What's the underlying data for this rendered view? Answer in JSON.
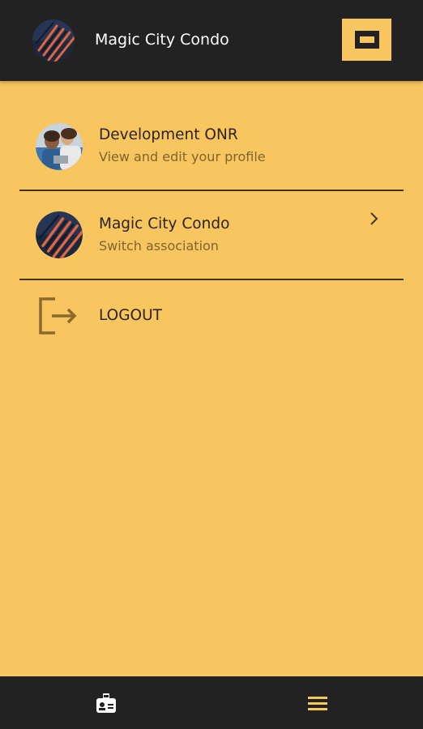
{
  "app_bar": {
    "title": "Magic City Condo",
    "logo_icon": "association-logo",
    "menu_icon": "menu-toggle-icon",
    "accent_color": "#f9c55e",
    "background_color": "#222222"
  },
  "profile": {
    "name": "Development ONR",
    "subtitle": "View and edit your profile",
    "avatar_icon": "user-avatar"
  },
  "association": {
    "name": "Magic City Condo",
    "subtitle": "Switch association",
    "avatar_icon": "association-logo",
    "chevron_icon": "chevron-right-icon"
  },
  "logout": {
    "label": "LOGOUT",
    "icon": "logout-icon"
  },
  "bottom_nav": {
    "items": [
      {
        "icon": "id-badge-icon"
      },
      {
        "icon": "hamburger-menu-icon"
      }
    ]
  }
}
